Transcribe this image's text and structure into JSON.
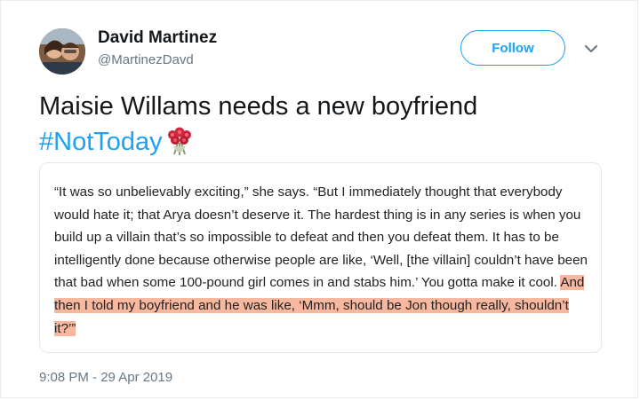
{
  "author": {
    "display_name": "David Martinez",
    "handle": "@MartinezDavd"
  },
  "actions": {
    "follow_label": "Follow",
    "menu_icon": "chevron-down-icon"
  },
  "tweet": {
    "text": "Maisie Willams needs a new boyfriend",
    "hashtag": "#NotToday",
    "emoji": "rose-bouquet-emoji",
    "timestamp": "9:08 PM - 29 Apr 2019"
  },
  "quote_card": {
    "text_plain": "“It was so unbelievably exciting,” she says. “But I immediately thought that everybody would hate it; that Arya doesn’t deserve it. The hardest thing is in any series is when you build up a villain that’s so impossible to defeat and then you defeat them. It has to be intelligently done because otherwise people are like, ‘Well, [the villain] couldn’t have been that bad when some 100-pound girl comes in and stabs him.’ You gotta make it cool. ",
    "text_highlighted": "And then I told my boyfriend and he was like, ‘Mmm, should be Jon though really, shouldn’t it?’”",
    "highlight_color": "#f7b89f"
  },
  "colors": {
    "accent": "#1da1f2",
    "secondary_text": "#657786"
  }
}
